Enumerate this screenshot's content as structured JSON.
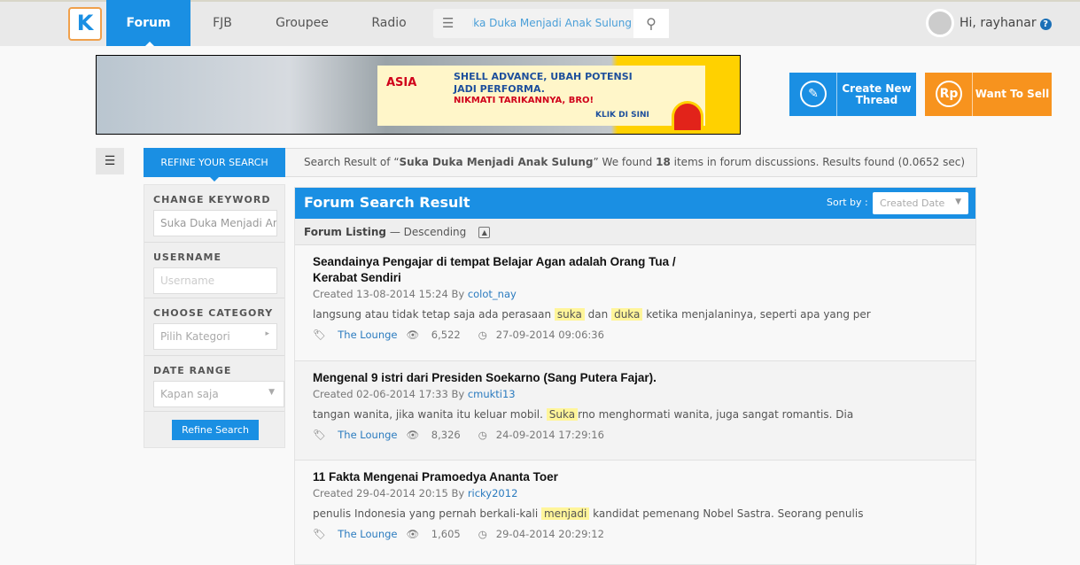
{
  "nav": {
    "logo": "K",
    "tabs": [
      "Forum",
      "FJB",
      "Groupee",
      "Radio"
    ],
    "active": "Forum",
    "search_value": "Suka Duka Menjadi Anak Sulung",
    "user_greeting": "Hi, rayhanar",
    "help": "?"
  },
  "banner": {
    "brand": "ASIA",
    "line1": "SHELL ADVANCE, UBAH POTENSI",
    "line1b": "JADI PERFORMA.",
    "line2": "NIKMATI TARIKANNYA, BRO!",
    "cta": "KLIK DI SINI"
  },
  "actions": {
    "create": "Create New Thread",
    "create_icon": "pencil-icon",
    "sell": "Want To Sell",
    "sell_icon": "Rp",
    "create_color": "#1a8fe3",
    "sell_color": "#f7931e"
  },
  "refine": {
    "tab": "REFINE YOUR SEARCH",
    "keyword_label": "CHANGE KEYWORD",
    "keyword_value": "Suka Duka Menjadi Anak Sulung",
    "username_label": "USERNAME",
    "username_placeholder": "Username",
    "category_label": "CHOOSE CATEGORY",
    "category_value": "Pilih Kategori",
    "date_label": "DATE RANGE",
    "date_value": "Kapan saja",
    "button": "Refine Search"
  },
  "result_summary": {
    "prefix": "Search Result of “",
    "query": "Suka Duka Menjadi Anak Sulung",
    "mid": "” We found ",
    "count": "18",
    "suffix": " items in forum discussions. Results found (0.0652 sec)"
  },
  "main": {
    "title": "Forum Search Result",
    "sort_label": "Sort by :",
    "sort_value": "Created Date",
    "listing_label": "Forum Listing",
    "listing_order": "— Descending"
  },
  "items": [
    {
      "title": "Seandainya Pengajar di tempat Belajar Agan adalah Orang Tua / Kerabat Sendiri",
      "created": "Created 13-08-2014 15:24 By ",
      "author": "colot_nay",
      "snippet": [
        {
          "t": "langsung atau tidak tetap saja ada perasaan "
        },
        {
          "t": "suka",
          "hl": true
        },
        {
          "t": " dan "
        },
        {
          "t": "duka",
          "hl": true
        },
        {
          "t": " ketika menjalaninya, seperti apa yang per"
        }
      ],
      "category": "The Lounge",
      "views": "6,522",
      "last": "27-09-2014 09:06:36"
    },
    {
      "title": "Mengenal 9 istri dari Presiden Soekarno (Sang Putera Fajar).",
      "created": "Created 02-06-2014 17:33 By ",
      "author": "cmukti13",
      "snippet": [
        {
          "t": "tangan wanita, jika wanita itu keluar mobil. "
        },
        {
          "t": "Suka",
          "hl": true
        },
        {
          "t": "rno menghormati wanita, juga sangat romantis. Dia"
        }
      ],
      "category": "The Lounge",
      "views": "8,326",
      "last": "24-09-2014 17:29:16"
    },
    {
      "title": "11 Fakta Mengenai Pramoedya Ananta Toer",
      "created": "Created 29-04-2014 20:15 By ",
      "author": "ricky2012",
      "snippet": [
        {
          "t": "penulis Indonesia yang pernah berkali-kali "
        },
        {
          "t": "menjadi",
          "hl": true
        },
        {
          "t": " kandidat pemenang Nobel Sastra. Seorang penulis"
        }
      ],
      "category": "The Lounge",
      "views": "1,605",
      "last": "29-04-2014 20:29:12"
    }
  ]
}
